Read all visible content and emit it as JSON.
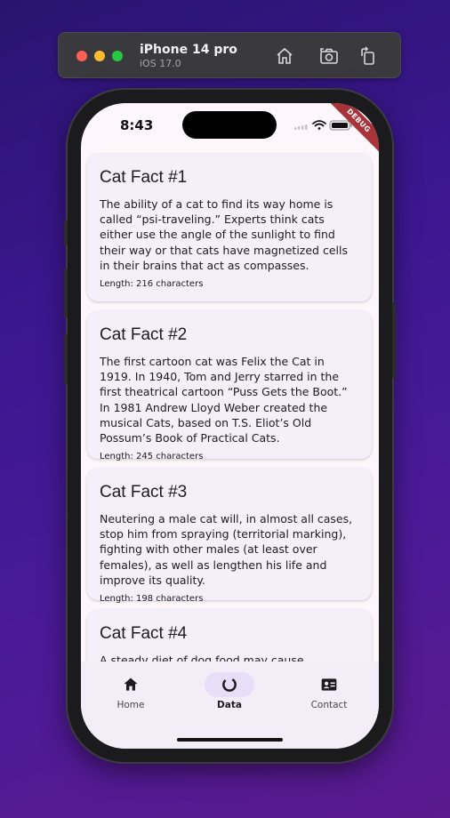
{
  "simulator": {
    "device_name": "iPhone 14 pro",
    "os_version": "iOS 17.0"
  },
  "status_bar": {
    "time": "8:43",
    "debug_label": "DEBUG"
  },
  "cards": [
    {
      "title": "Cat Fact #1",
      "fact": "The ability of a cat to find its way home is called “psi-traveling.” Experts think cats either use the angle of the sunlight to find their way or that cats have magnetized cells in their brains that act as compasses.",
      "length": "Length: 216 characters"
    },
    {
      "title": "Cat Fact #2",
      "fact": "The first cartoon cat was Felix the Cat in 1919. In 1940, Tom and Jerry starred in the first theatrical cartoon “Puss Gets the Boot.” In 1981 Andrew Lloyd Weber created the musical Cats, based on T.S. Eliot’s Old Possum’s Book of Practical Cats.",
      "length": "Length: 245 characters"
    },
    {
      "title": "Cat Fact #3",
      "fact": "Neutering a male cat will, in almost all cases, stop him from spraying (territorial marking), fighting with other males (at least over females), as well as lengthen his life and improve its quality.",
      "length": "Length: 198 characters"
    },
    {
      "title": "Cat Fact #4",
      "fact": "A steady diet of dog food may cause blindness in",
      "length": ""
    }
  ],
  "nav": {
    "items": [
      {
        "label": "Home",
        "icon": "home-icon",
        "active": false
      },
      {
        "label": "Data",
        "icon": "loading-icon",
        "active": true
      },
      {
        "label": "Contact",
        "icon": "contact-card-icon",
        "active": false
      }
    ]
  },
  "colors": {
    "screen_bg": "#fdf7fc",
    "card_bg": "#f5eff9",
    "nav_indicator": "#e8def8",
    "debug_ribbon": "#a8343a"
  }
}
